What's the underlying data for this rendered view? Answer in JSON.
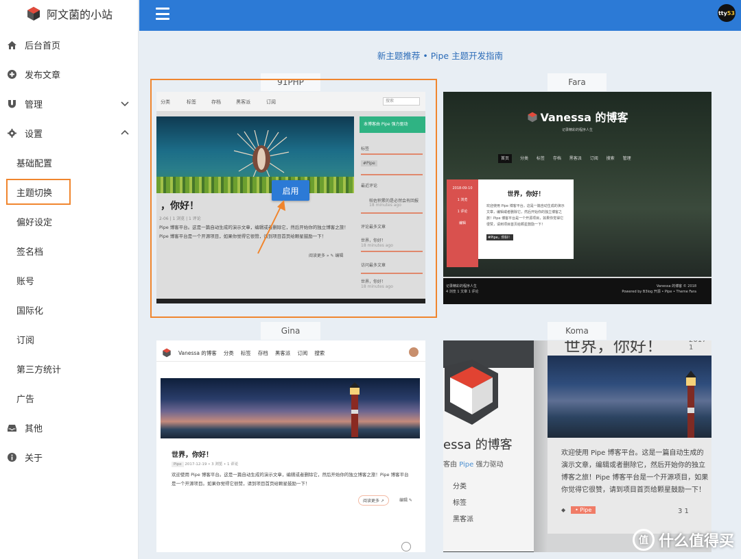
{
  "brand": {
    "title": "阿文菌的小站"
  },
  "sidebar": {
    "items": [
      {
        "label": "后台首页",
        "icon": "home-icon"
      },
      {
        "label": "发布文章",
        "icon": "plus-circle-icon"
      },
      {
        "label": "管理",
        "icon": "magnet-icon"
      },
      {
        "label": "设置",
        "icon": "gear-icon"
      }
    ],
    "subitems": [
      {
        "label": "基础配置"
      },
      {
        "label": "主题切换"
      },
      {
        "label": "偏好设定"
      },
      {
        "label": "签名档"
      },
      {
        "label": "账号"
      },
      {
        "label": "国际化"
      },
      {
        "label": "订阅"
      },
      {
        "label": "第三方统计"
      },
      {
        "label": "广告"
      }
    ],
    "bottom_items": [
      {
        "label": "其他",
        "icon": "inbox-icon"
      },
      {
        "label": "关于",
        "icon": "info-icon"
      }
    ]
  },
  "header": {
    "avatar_text_a": "tty",
    "avatar_text_b": "53"
  },
  "main": {
    "recommend_text": "新主题推荐 • Pipe 主题开发指南",
    "enable_label": "启用"
  },
  "themes": [
    {
      "name": "91PHP",
      "nav": [
        "分类",
        "标签",
        "存档",
        "黑客派",
        "订阅"
      ],
      "search": "搜索",
      "post_title": "，你好！",
      "meta": "2-06 | 1 浏览 | 1 评论",
      "text": "Pipe 博客平台。这是一篇自动生成的演示文章，编辑或者删除它，然后开始你的独立博客之旅！Pipe 博客平台是一个开源项目，如果你觉得它很赞，请到项目首页给颗星鼓励一下！",
      "more": "阅读更多 » ✎ 编辑",
      "side_green": "本博客由 Pipe 强力驱动",
      "side_tags": "标签",
      "side_tag_item": "#Pipe",
      "side_recent": "最近评论",
      "side_comment": "帕佐积累的是必然会有回报",
      "side_comment_time": "18 minutes ago",
      "side_hot": "评论最多文章",
      "side_hot_item": "世界，你好！",
      "side_hot_time": "18 minutes ago",
      "side_visit": "访问最多文章",
      "side_visit_item": "世界，你好！",
      "side_visit_time": "18 minutes ago"
    },
    {
      "name": "Fara",
      "title": "Vanessa 的博客",
      "subtitle": "记录精彩的程序人生",
      "nav": [
        "首页",
        "分类",
        "标签",
        "存档",
        "黑客派",
        "订阅",
        "搜索",
        "管理"
      ],
      "date": "2018-09-10",
      "views": "1 浏览",
      "comments": "1 评论",
      "edit": "编辑",
      "post_title": "世界，你好！",
      "text": "欢迎使用 Pipe 博客平台。这是一篇自动生成的演示文章，编辑或者删除它，然后开始你的独立博客之旅！Pipe 博客平台是一个开源项目，如果你觉得它很赞，请到项目首页给颗星鼓励一下！",
      "tag": "#Pipe，你好！",
      "footer_left_a": "记录精彩的程序人生",
      "footer_left_b": "4 浏览 1 文章 1 评论",
      "footer_right_a": "Vanessa 的博客 © 2018",
      "footer_right_b": "Powered by B3log 开源 • Pipe • Theme Fara"
    },
    {
      "name": "Gina",
      "blog": "Vanessa 的博客",
      "nav": [
        "分类",
        "标签",
        "存档",
        "黑客派",
        "订阅",
        "搜索"
      ],
      "post_title": "世界，你好！",
      "tag": "Pipe",
      "meta": "2017-12-19 • 3 浏览 • 1 评论",
      "text": "欢迎使用 Pipe 博客平台。这是一篇自动生成的演示文章，编辑或者删除它，然后开始你的独立博客之旅！Pipe 博客平台是一个开源项目。如果你觉得它很赞，请到项目首页给颗星鼓励一下！",
      "more": "阅读更多 ↗",
      "edit": "编辑 ✎"
    },
    {
      "name": "Koma",
      "blog": "essa 的博客",
      "powered_a": "客由 ",
      "powered_b": "Pipe",
      "powered_c": " 强力驱动",
      "list": [
        "分类",
        "标签",
        "黑客派"
      ],
      "post_title": "世界，你好！",
      "date": "2017-1",
      "text": "欢迎使用 Pipe 博客平台。这是一篇自动生成的演示文章，编辑或者删除它，然后开始你的独立博客之旅！Pipe 博客平台是一个开源项目，如果你觉得它很赞，请到项目首页给颗星鼓励一下！",
      "tag": "• Pipe",
      "count": "3   1"
    }
  ],
  "watermark": {
    "text": "什么值得买",
    "logo": "值"
  },
  "colors": {
    "header": "#2c7ad6",
    "highlight": "#f0852d",
    "link": "#2c6cb8"
  }
}
